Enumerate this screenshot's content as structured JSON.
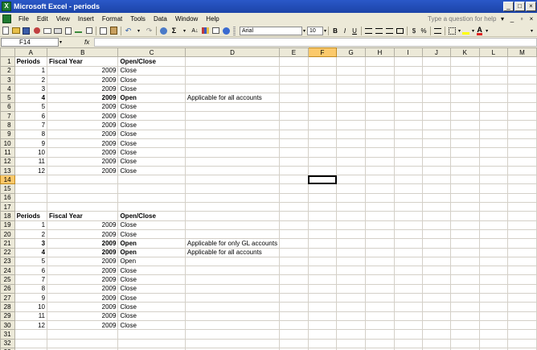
{
  "window": {
    "title": "Microsoft Excel - periods",
    "app_icon": "X",
    "min": "_",
    "max": "□",
    "close": "×"
  },
  "menu": {
    "items": [
      "File",
      "Edit",
      "View",
      "Insert",
      "Format",
      "Tools",
      "Data",
      "Window",
      "Help"
    ],
    "help_placeholder": "Type a question for help",
    "doc_min": "_",
    "doc_restore": "▫",
    "doc_close": "×"
  },
  "toolbar": {
    "font": "Arial",
    "size": "10",
    "bold": "B",
    "italic": "I",
    "underline": "U",
    "currency": "$",
    "percent": "%"
  },
  "formula": {
    "name_box": "F14",
    "fx": "fx"
  },
  "columns": [
    "A",
    "B",
    "C",
    "D",
    "E",
    "F",
    "G",
    "H",
    "I",
    "J",
    "K",
    "L",
    "M"
  ],
  "selected_col": "F",
  "selected_row": 14,
  "rows": [
    {
      "n": 1,
      "a": "Periods",
      "b": "Fiscal Year",
      "c": "Open/Close",
      "d": "",
      "bold": true,
      "header": true
    },
    {
      "n": 2,
      "a": "1",
      "b": "2009",
      "c": "Close",
      "d": "",
      "bold": false
    },
    {
      "n": 3,
      "a": "2",
      "b": "2009",
      "c": "Close",
      "d": "",
      "bold": false
    },
    {
      "n": 4,
      "a": "3",
      "b": "2009",
      "c": "Close",
      "d": "",
      "bold": false
    },
    {
      "n": 5,
      "a": "4",
      "b": "2009",
      "c": "Open",
      "d": "Applicable for all accounts",
      "bold": true
    },
    {
      "n": 6,
      "a": "5",
      "b": "2009",
      "c": "Close",
      "d": "",
      "bold": false
    },
    {
      "n": 7,
      "a": "6",
      "b": "2009",
      "c": "Close",
      "d": "",
      "bold": false
    },
    {
      "n": 8,
      "a": "7",
      "b": "2009",
      "c": "Close",
      "d": "",
      "bold": false
    },
    {
      "n": 9,
      "a": "8",
      "b": "2009",
      "c": "Close",
      "d": "",
      "bold": false
    },
    {
      "n": 10,
      "a": "9",
      "b": "2009",
      "c": "Close",
      "d": "",
      "bold": false
    },
    {
      "n": 11,
      "a": "10",
      "b": "2009",
      "c": "Close",
      "d": "",
      "bold": false
    },
    {
      "n": 12,
      "a": "11",
      "b": "2009",
      "c": "Close",
      "d": "",
      "bold": false
    },
    {
      "n": 13,
      "a": "12",
      "b": "2009",
      "c": "Close",
      "d": "",
      "bold": false
    },
    {
      "n": 14,
      "a": "",
      "b": "",
      "c": "",
      "d": "",
      "bold": false
    },
    {
      "n": 15,
      "a": "",
      "b": "",
      "c": "",
      "d": "",
      "bold": false
    },
    {
      "n": 16,
      "a": "",
      "b": "",
      "c": "",
      "d": "",
      "bold": false
    },
    {
      "n": 17,
      "a": "",
      "b": "",
      "c": "",
      "d": "",
      "bold": false
    },
    {
      "n": 18,
      "a": "Periods",
      "b": "Fiscal Year",
      "c": "Open/Close",
      "d": "",
      "bold": true,
      "header": true
    },
    {
      "n": 19,
      "a": "1",
      "b": "2009",
      "c": "Close",
      "d": "",
      "bold": false
    },
    {
      "n": 20,
      "a": "2",
      "b": "2009",
      "c": "Close",
      "d": "",
      "bold": false
    },
    {
      "n": 21,
      "a": "3",
      "b": "2009",
      "c": "Open",
      "d": "Applicable for only GL accounts",
      "bold": true
    },
    {
      "n": 22,
      "a": "4",
      "b": "2009",
      "c": "Open",
      "d": "Applicable for all accounts",
      "bold": true
    },
    {
      "n": 23,
      "a": "5",
      "b": "2009",
      "c": "Open",
      "d": "",
      "bold": false
    },
    {
      "n": 24,
      "a": "6",
      "b": "2009",
      "c": "Close",
      "d": "",
      "bold": false
    },
    {
      "n": 25,
      "a": "7",
      "b": "2009",
      "c": "Close",
      "d": "",
      "bold": false
    },
    {
      "n": 26,
      "a": "8",
      "b": "2009",
      "c": "Close",
      "d": "",
      "bold": false
    },
    {
      "n": 27,
      "a": "9",
      "b": "2009",
      "c": "Close",
      "d": "",
      "bold": false
    },
    {
      "n": 28,
      "a": "10",
      "b": "2009",
      "c": "Close",
      "d": "",
      "bold": false
    },
    {
      "n": 29,
      "a": "11",
      "b": "2009",
      "c": "Close",
      "d": "",
      "bold": false
    },
    {
      "n": 30,
      "a": "12",
      "b": "2009",
      "c": "Close",
      "d": "",
      "bold": false
    },
    {
      "n": 31,
      "a": "",
      "b": "",
      "c": "",
      "d": "",
      "bold": false
    },
    {
      "n": 32,
      "a": "",
      "b": "",
      "c": "",
      "d": "",
      "bold": false
    },
    {
      "n": 33,
      "a": "",
      "b": "",
      "c": "",
      "d": "",
      "bold": false
    }
  ],
  "colors": {
    "title_bar": "#2a58c8",
    "chrome": "#ece9d8",
    "selection_header": "#fbc96b"
  }
}
